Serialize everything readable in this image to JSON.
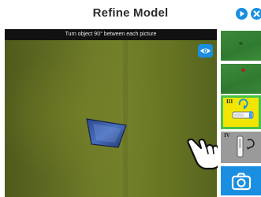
{
  "header": {
    "title": "Refine Model",
    "play_icon": "play-icon",
    "close_icon": "close-icon"
  },
  "camera": {
    "instruction": "Turn object 90° between each picture",
    "eye_icon": "eye-icon"
  },
  "steps": [
    {
      "numeral": "",
      "state": "captured"
    },
    {
      "numeral": "",
      "state": "captured"
    },
    {
      "numeral": "III",
      "state": "current"
    },
    {
      "numeral": "IV",
      "state": "pending"
    }
  ],
  "capture_icon": "camera-icon",
  "pointer_icon": "hand-pointer-icon",
  "colors": {
    "accent": "#1a8ee0",
    "highlight": "#f2e600",
    "selected_border": "#49c249",
    "pending": "#9a9a9a"
  }
}
